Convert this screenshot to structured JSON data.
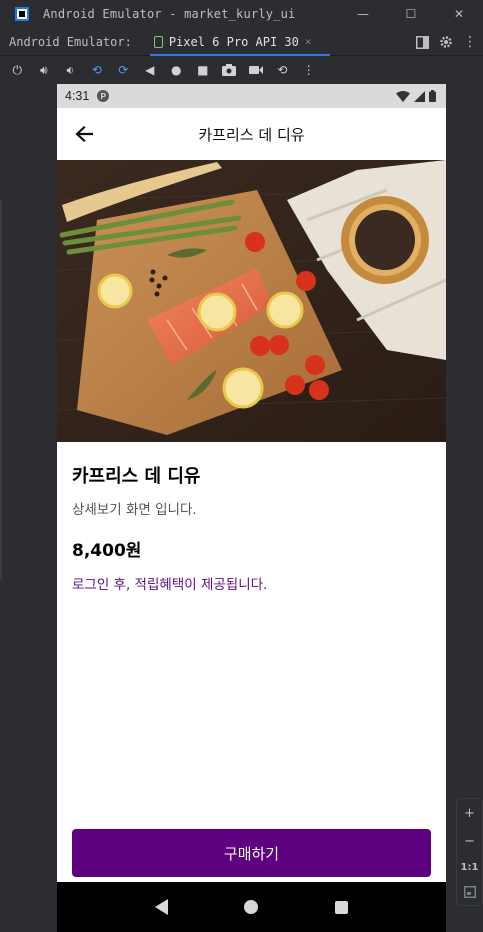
{
  "window": {
    "title": "Android Emulator - market_kurly_ui",
    "controls": {
      "minimize": "—",
      "maximize": "☐",
      "close": "✕"
    }
  },
  "tabbar": {
    "label": "Android Emulator:",
    "device_tab": "Pixel 6 Pro API 30",
    "close": "×"
  },
  "toolbar": {
    "icons": [
      "power-icon",
      "volume-up-icon",
      "volume-down-icon",
      "rotate-left-icon",
      "rotate-right-icon",
      "back-icon",
      "home-icon",
      "overview-icon",
      "screenshot-icon",
      "camera-icon",
      "snapshot-icon",
      "more-icon"
    ]
  },
  "zoom": {
    "in": "+",
    "out": "−",
    "ratio": "1:1"
  },
  "phone": {
    "status": {
      "time": "4:31",
      "badge": "P"
    },
    "appbar": {
      "title": "카프리스 데 디유"
    },
    "product": {
      "name": "카프리스 데 디유",
      "description": "상세보기 화면 입니다.",
      "price": "8,400원",
      "note": "로그인 후, 적립혜택이 제공됩니다."
    },
    "buy_button": "구매하기",
    "colors": {
      "accent": "#5f0080",
      "note": "#5a0f86"
    }
  }
}
